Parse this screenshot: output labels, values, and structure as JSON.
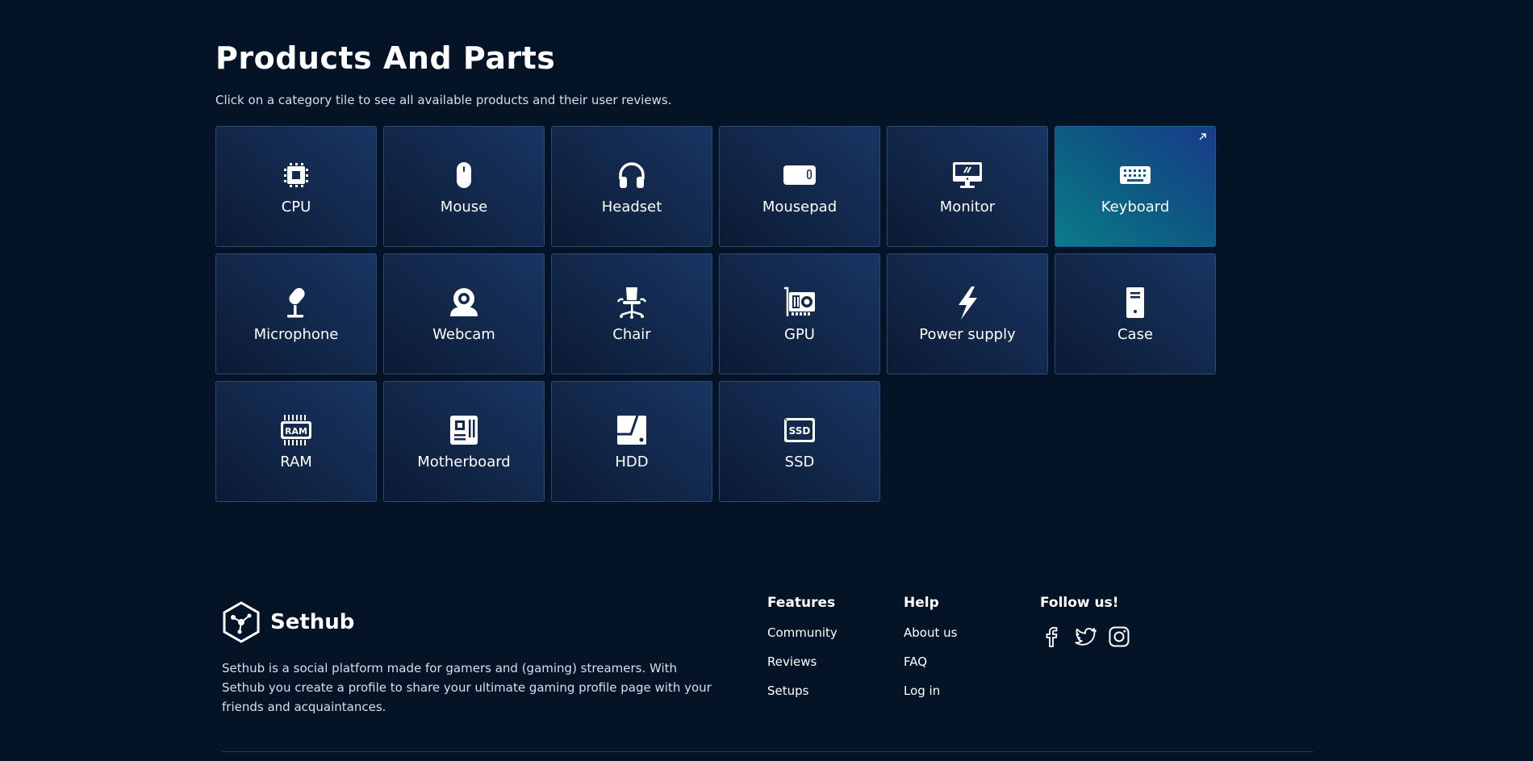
{
  "page": {
    "title": "Products And Parts",
    "subtitle": "Click on a category tile to see all available products and their user reviews."
  },
  "categories": [
    {
      "label": "CPU",
      "icon": "cpu-icon"
    },
    {
      "label": "Mouse",
      "icon": "mouse-icon"
    },
    {
      "label": "Headset",
      "icon": "headset-icon"
    },
    {
      "label": "Mousepad",
      "icon": "mousepad-icon"
    },
    {
      "label": "Monitor",
      "icon": "monitor-icon"
    },
    {
      "label": "Keyboard",
      "icon": "keyboard-icon",
      "active": true
    },
    {
      "label": "Microphone",
      "icon": "microphone-icon"
    },
    {
      "label": "Webcam",
      "icon": "webcam-icon"
    },
    {
      "label": "Chair",
      "icon": "chair-icon"
    },
    {
      "label": "GPU",
      "icon": "gpu-icon"
    },
    {
      "label": "Power supply",
      "icon": "lightning-icon"
    },
    {
      "label": "Case",
      "icon": "case-icon"
    },
    {
      "label": "RAM",
      "icon": "ram-icon"
    },
    {
      "label": "Motherboard",
      "icon": "motherboard-icon"
    },
    {
      "label": "HDD",
      "icon": "hdd-icon"
    },
    {
      "label": "SSD",
      "icon": "ssd-icon"
    }
  ],
  "footer": {
    "brand": "Sethub",
    "description": "Sethub is a social platform made for gamers and (gaming) streamers. With Sethub you create a profile to share your ultimate gaming profile page with your friends and acquaintances.",
    "features": {
      "heading": "Features",
      "links": [
        "Community",
        "Reviews",
        "Setups"
      ]
    },
    "help": {
      "heading": "Help",
      "links": [
        "About us",
        "FAQ",
        "Log in"
      ]
    },
    "follow": {
      "heading": "Follow us!",
      "icons": [
        "facebook-icon",
        "twitter-icon",
        "instagram-icon"
      ]
    }
  },
  "colors": {
    "background": "#041426",
    "tile_border": "#2a4b76",
    "active_teal": "#0a7c88",
    "active_blue": "#183b8a"
  }
}
